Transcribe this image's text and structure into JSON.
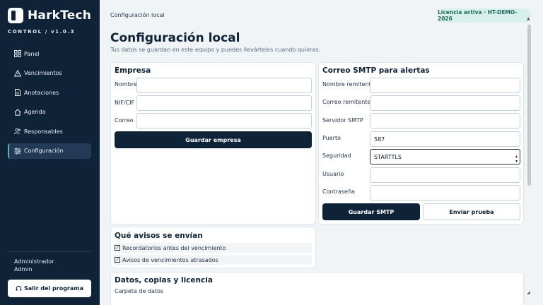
{
  "brand": {
    "name": "HarkTech",
    "subtitle": "CONTROL / v1.0.3"
  },
  "nav": [
    {
      "label": "Panel",
      "icon": "grid-icon"
    },
    {
      "label": "Vencimientos",
      "icon": "warning-icon"
    },
    {
      "label": "Anotaciones",
      "icon": "document-icon"
    },
    {
      "label": "Agenda",
      "icon": "home-icon"
    },
    {
      "label": "Responsables",
      "icon": "users-icon"
    },
    {
      "label": "Configuración",
      "icon": "sliders-icon",
      "active": true
    }
  ],
  "user": {
    "role": "Administrador",
    "name": "Admin"
  },
  "exit_label": "Salir del programa",
  "header": {
    "breadcrumb": "Configuración local",
    "license": "Licencia activa · HT-DEMO-2026",
    "title": "Configuración local",
    "subtitle": "Tus datos se guardan en este equipo y puedes llevártelos cuando quieras."
  },
  "empresa": {
    "title": "Empresa",
    "fields": [
      {
        "label": "Nombre",
        "value": ""
      },
      {
        "label": "NIF/CIF",
        "value": ""
      },
      {
        "label": "Correo",
        "value": ""
      }
    ],
    "save_label": "Guardar empresa"
  },
  "smtp": {
    "title": "Correo SMTP para alertas",
    "fields": [
      {
        "label": "Nombre remitente",
        "value": ""
      },
      {
        "label": "Correo remitente",
        "value": ""
      },
      {
        "label": "Servidor SMTP",
        "value": ""
      },
      {
        "label": "Puerto",
        "value": "587"
      },
      {
        "label": "Seguridad",
        "value": "STARTTLS"
      },
      {
        "label": "Usuario",
        "value": ""
      },
      {
        "label": "Contraseña",
        "value": ""
      }
    ],
    "save_label": "Guardar SMTP",
    "test_label": "Enviar prueba"
  },
  "avisos": {
    "title": "Qué avisos se envían",
    "items": [
      {
        "label": "Recordatorios antes del vencimiento",
        "checked": true
      },
      {
        "label": "Avisos de vencimientos atrasados",
        "checked": true
      }
    ]
  },
  "datos": {
    "title": "Datos, copias y licencia",
    "folder_label": "Carpeta de datos"
  },
  "colors": {
    "sidebar": "#0e2238",
    "accent": "#5db3a8",
    "license_bg": "#d7f0ea",
    "primary_button": "#0e2238"
  }
}
